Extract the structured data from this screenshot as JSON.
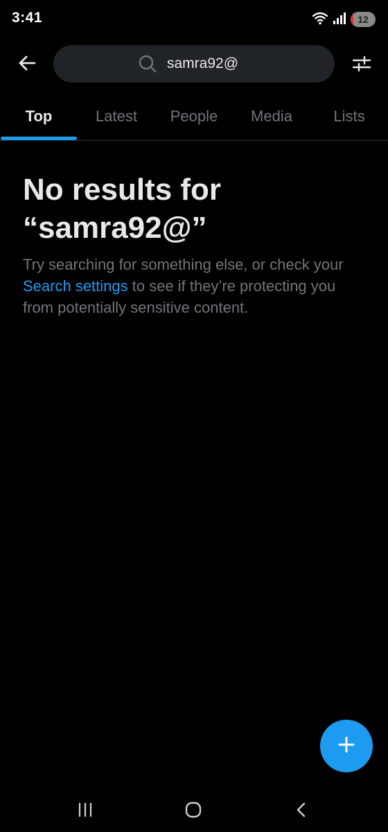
{
  "status_bar": {
    "time": "3:41",
    "battery_level": "12",
    "battery_fill_fraction": 0.12,
    "icons": [
      "wifi-icon",
      "signal-icon",
      "battery-icon"
    ]
  },
  "search": {
    "query": "samra92@",
    "icon": "search-icon"
  },
  "header": {
    "back_icon": "arrow-left-icon",
    "filter_icon": "sliders-icon"
  },
  "tabs": [
    {
      "label": "Top",
      "active": true
    },
    {
      "label": "Latest",
      "active": false
    },
    {
      "label": "People",
      "active": false
    },
    {
      "label": "Media",
      "active": false
    },
    {
      "label": "Lists",
      "active": false
    }
  ],
  "empty_state": {
    "title": "No results for “samra92@”",
    "body_before_link": "Try searching for something else, or check your ",
    "link_label": "Search settings",
    "body_after_link": " to see if they’re protecting you from potentially sensitive content."
  },
  "fab": {
    "icon": "plus-icon"
  },
  "nav_bar": {
    "icons": [
      "recent-apps-icon",
      "home-icon",
      "back-icon"
    ]
  },
  "colors": {
    "background": "#000000",
    "accent": "#1d9bf0",
    "text_primary": "#e7e9ea",
    "text_secondary": "#71767b",
    "search_bg": "#202327",
    "divider": "#2f3336",
    "battery_low": "#e0332e"
  }
}
